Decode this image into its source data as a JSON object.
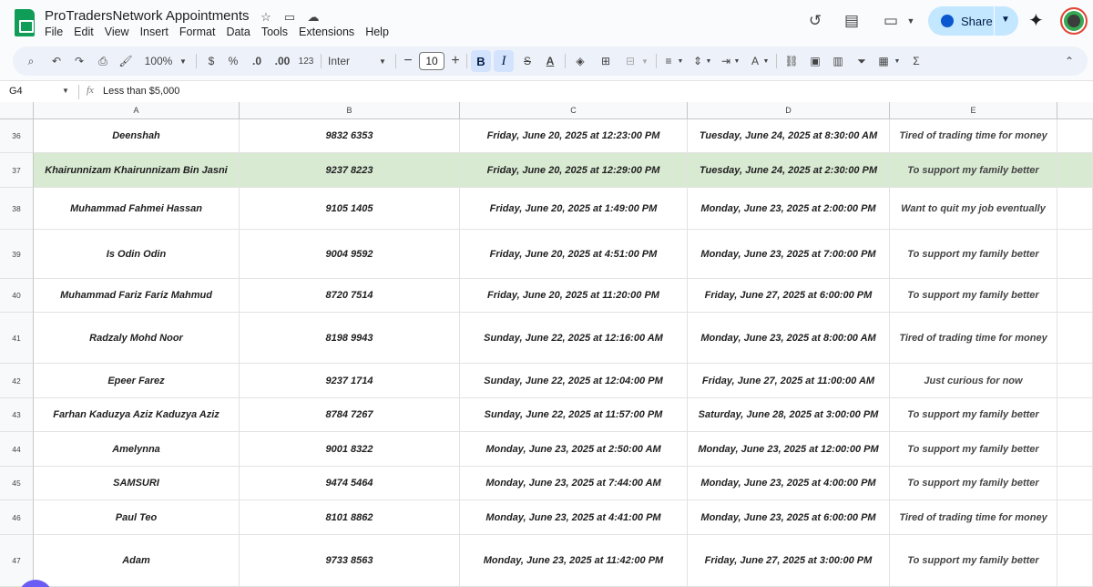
{
  "title_bar": {
    "doc_title": "ProTradersNetwork Appointments",
    "menu": [
      "File",
      "Edit",
      "View",
      "Insert",
      "Format",
      "Data",
      "Tools",
      "Extensions",
      "Help"
    ],
    "share_label": "Share"
  },
  "toolbar": {
    "zoom": "100%",
    "currency": "$",
    "percent": "%",
    "dec_decrease": ".0",
    "dec_increase": ".00",
    "number_format": "123",
    "font": "Inter",
    "font_size": "10",
    "bold": "B",
    "italic": "I"
  },
  "formula_bar": {
    "cell_ref": "G4",
    "fx": "fx",
    "value": "Less than $5,000"
  },
  "columns": [
    "A",
    "B",
    "C",
    "D",
    "E"
  ],
  "rows": [
    {
      "num": "36",
      "name": "Deenshah",
      "phone": "9832 6353",
      "submitted": "Friday, June 20, 2025 at 12:23:00 PM",
      "appointment": "Tuesday, June 24, 2025 at 8:30:00 AM",
      "reason": "Tired of trading time for money"
    },
    {
      "num": "37",
      "name": "Khairunnizam Khairunnizam Bin Jasni",
      "phone": "9237 8223",
      "submitted": "Friday, June 20, 2025 at 12:29:00 PM",
      "appointment": "Tuesday, June 24, 2025 at 2:30:00 PM",
      "reason": "To support my family better"
    },
    {
      "num": "38",
      "name": "Muhammad Fahmei Hassan",
      "phone": "9105 1405",
      "submitted": "Friday, June 20, 2025 at 1:49:00 PM",
      "appointment": "Monday, June 23, 2025 at 2:00:00 PM",
      "reason": "Want to quit my job eventually"
    },
    {
      "num": "39",
      "name": "Is Odin Odin",
      "phone": "9004 9592",
      "submitted": "Friday, June 20, 2025 at 4:51:00 PM",
      "appointment": "Monday, June 23, 2025 at 7:00:00 PM",
      "reason": "To support my family better"
    },
    {
      "num": "40",
      "name": "Muhammad Fariz Fariz Mahmud",
      "phone": "8720 7514",
      "submitted": "Friday, June 20, 2025 at 11:20:00 PM",
      "appointment": "Friday, June 27, 2025 at 6:00:00 PM",
      "reason": "To support my family better"
    },
    {
      "num": "41",
      "name": "Radzaly Mohd Noor",
      "phone": "8198 9943",
      "submitted": "Sunday, June 22, 2025 at 12:16:00 AM",
      "appointment": "Monday, June 23, 2025 at 8:00:00 AM",
      "reason": "Tired of trading time for money"
    },
    {
      "num": "42",
      "name": "Epeer Farez",
      "phone": "9237 1714",
      "submitted": "Sunday, June 22, 2025 at 12:04:00 PM",
      "appointment": "Friday, June 27, 2025 at 11:00:00 AM",
      "reason": "Just curious for now"
    },
    {
      "num": "43",
      "name": "Farhan Kaduzya Aziz Kaduzya Aziz",
      "phone": "8784 7267",
      "submitted": "Sunday, June 22, 2025 at 11:57:00 PM",
      "appointment": "Saturday, June 28, 2025 at 3:00:00 PM",
      "reason": "To support my family better"
    },
    {
      "num": "44",
      "name": "Amelynna",
      "phone": "9001 8322",
      "submitted": "Monday, June 23, 2025 at 2:50:00 AM",
      "appointment": "Monday, June 23, 2025 at 12:00:00 PM",
      "reason": "To support my family better"
    },
    {
      "num": "45",
      "name": "SAMSURI",
      "phone": "9474 5464",
      "submitted": "Monday, June 23, 2025 at 7:44:00 AM",
      "appointment": "Monday, June 23, 2025 at 4:00:00 PM",
      "reason": "To support my family better"
    },
    {
      "num": "46",
      "name": "Paul Teo",
      "phone": "8101 8862",
      "submitted": "Monday, June 23, 2025 at 4:41:00 PM",
      "appointment": "Monday, June 23, 2025 at 6:00:00 PM",
      "reason": "Tired of trading time for money"
    },
    {
      "num": "47",
      "name": "Adam",
      "phone": "9733 8563",
      "submitted": "Monday, June 23, 2025 at 11:42:00 PM",
      "appointment": "Friday, June 27, 2025 at 3:00:00 PM",
      "reason": "To support my family better"
    }
  ]
}
